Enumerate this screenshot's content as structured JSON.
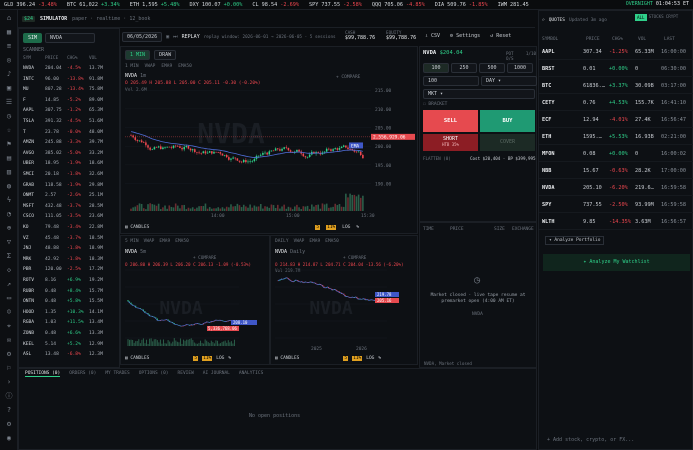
{
  "ticker": [
    {
      "sym": "GLD",
      "px": "396.24",
      "chg": "-3.48%",
      "dir": "neg"
    },
    {
      "sym": "BTC",
      "px": "61,022",
      "chg": "+3.34%",
      "dir": "pos"
    },
    {
      "sym": "ETH",
      "px": "1,595",
      "chg": "+5.48%",
      "dir": "pos"
    },
    {
      "sym": "DXY",
      "px": "100.07",
      "chg": "+0.00%",
      "dir": "pos"
    },
    {
      "sym": "CL",
      "px": "98.54",
      "chg": "-2.69%",
      "dir": "neg"
    },
    {
      "sym": "SPY",
      "px": "737.55",
      "chg": "-2.58%",
      "dir": "neg"
    },
    {
      "sym": "QQQ",
      "px": "705.06",
      "chg": "-4.85%",
      "dir": "neg"
    },
    {
      "sym": "DIA",
      "px": "509.76",
      "chg": "-1.85%",
      "dir": "neg"
    },
    {
      "sym": "IWM",
      "px": "281.45",
      "chg": "",
      "dir": "pos"
    }
  ],
  "ticker_right": {
    "label": "OVERNIGHT",
    "time": "01:04:53 ET"
  },
  "topbar": {
    "badge": "$24",
    "app": "SIMULATOR",
    "mode": "paper · realtime · 12_book",
    "date": "06/05/2026",
    "replay": "REPLAY",
    "replay_window": "replay window: 2026-06-01 → 2026-06-05 · 5 sessions",
    "cash_label": "CASH",
    "cash": "$99,788.76",
    "equity_label": "EQUITY",
    "equity": "$99,788.76",
    "csv": "CSV",
    "settings": "Settings",
    "reset": "Reset"
  },
  "scanner": {
    "tabs": [
      "SIM",
      "NVDA"
    ],
    "title": "SCANNER",
    "cols": [
      "SYM",
      "PRICE",
      "CHG%",
      "VOL"
    ],
    "rows": [
      [
        "NVDA",
        "204.04",
        "-4.5%",
        "13.7M",
        "neg"
      ],
      [
        "INTC",
        "96.00",
        "-13.8%",
        "91.8M",
        "neg"
      ],
      [
        "MU",
        "807.28",
        "-13.4%",
        "75.8M",
        "neg"
      ],
      [
        "F",
        "14.85",
        "-5.2%",
        "89.0M",
        "neg"
      ],
      [
        "AAPL",
        "307.75",
        "-1.2%",
        "65.3M",
        "neg"
      ],
      [
        "TSLA",
        "391.32",
        "-4.5%",
        "51.6M",
        "neg"
      ],
      [
        "T",
        "23.78",
        "-0.0%",
        "48.0M",
        "neg"
      ],
      [
        "AMZN",
        "245.88",
        "-3.3%",
        "39.7M",
        "neg"
      ],
      [
        "AVGO",
        "385.02",
        "-5.0%",
        "33.2M",
        "neg"
      ],
      [
        "UBER",
        "18.95",
        "-1.9%",
        "18.6M",
        "neg"
      ],
      [
        "SMCI",
        "20.18",
        "-1.8%",
        "32.6M",
        "neg"
      ],
      [
        "GRAB",
        "118.58",
        "-1.9%",
        "29.8M",
        "neg"
      ],
      [
        "ONMT",
        "2.57",
        "-2.6%",
        "25.1M",
        "neg"
      ],
      [
        "MSFT",
        "432.48",
        "-3.7%",
        "28.5M",
        "neg"
      ],
      [
        "CSCO",
        "111.05",
        "-3.5%",
        "23.6M",
        "neg"
      ],
      [
        "KO",
        "79.48",
        "-3.4%",
        "22.8M",
        "neg"
      ],
      [
        "VZ",
        "45.48",
        "-3.7%",
        "18.5M",
        "neg"
      ],
      [
        "JNJ",
        "48.88",
        "-1.8%",
        "18.9M",
        "neg"
      ],
      [
        "MRK",
        "42.92",
        "-1.8%",
        "18.3M",
        "neg"
      ],
      [
        "PBR",
        "120.00",
        "-2.5%",
        "17.2M",
        "neg"
      ],
      [
        "ROTV",
        "8.16",
        "+6.9%",
        "19.2M",
        "pos"
      ],
      [
        "RUBR",
        "0.48",
        "+8.4%",
        "15.7M",
        "pos"
      ],
      [
        "ONTN",
        "0.48",
        "+5.8%",
        "15.5M",
        "pos"
      ],
      [
        "HOOD",
        "1.35",
        "+10.3%",
        "14.1M",
        "pos"
      ],
      [
        "RGBA",
        "1.03",
        "+11.5%",
        "13.4M",
        "pos"
      ],
      [
        "ZONB",
        "0.48",
        "+6.6%",
        "13.3M",
        "pos"
      ],
      [
        "KEEL",
        "5.14",
        "+5.2%",
        "12.9M",
        "pos"
      ],
      [
        "ASL",
        "13.48",
        "-6.8%",
        "12.3M",
        "neg"
      ]
    ]
  },
  "chart_main": {
    "tab_active": "1 MIN",
    "tab_alt": "DRAW",
    "sub_tabs": [
      "1 MIN",
      "VWAP",
      "EMA9",
      "EMA50"
    ],
    "symbol": "NVDA",
    "tf": "1m",
    "ohlc": "O 205.49  H 205.88  L 205.00  C 205.11  -0.30 (-0.20%)",
    "vol": "Vol 2.6M",
    "compare": "+ COMPARE",
    "price_tag": "208.60",
    "last_tag": "2,556,929.06",
    "ema_tag": "EMA",
    "watermark": "NVDA",
    "footer": [
      "CANDLES",
      "5",
      "11%",
      "LOG",
      "%"
    ]
  },
  "chart_data": {
    "type": "line",
    "title": "NVDA 1m",
    "yticks": [
      215,
      210,
      205,
      200,
      195,
      190
    ],
    "xticks": [
      "14:00",
      "15:00",
      "15:30"
    ],
    "ylim": [
      188,
      218
    ],
    "series": [
      {
        "name": "EMA"
      }
    ]
  },
  "chart_small_1": {
    "symbol": "NVDA",
    "tf": "5m",
    "sub_tabs": [
      "5 MIN",
      "VWAP",
      "EMA9",
      "EMA50"
    ],
    "ohlc": "O 206.80  H 206.39  L 206.20  C 206.13  -1.09 (-0.53%)",
    "compare": "+ COMPARE",
    "price_tag": "208.10",
    "last_tag": "5,336,768.06",
    "footer": [
      "CANDLES",
      "5",
      "11%",
      "LOG",
      "%"
    ]
  },
  "chart_small_2": {
    "symbol": "NVDA",
    "tf": "Daily",
    "sub_tabs": [
      "DAILY",
      "VWAP",
      "EMA9",
      "EMA50"
    ],
    "ohlc": "O 214.83  H 214.87  L 204.71  C 204.04  -13.56 (-6.20%)",
    "vol": "Vol 219.7M",
    "compare": "+ COMPARE",
    "price_tag": "219.78",
    "last_tag": "205.16",
    "xticks": [
      "2025",
      "2026"
    ],
    "footer": [
      "CANDLES",
      "5",
      "11%",
      "LOG",
      "%"
    ]
  },
  "order_panel": {
    "symbol": "NVDA",
    "price": "$204.04",
    "tags": [
      "POT O/S",
      "1/10"
    ],
    "qty_tabs": [
      "100",
      "250",
      "500",
      "1000"
    ],
    "qty": "100",
    "tif": "DAY",
    "order_type": "MKT",
    "bracket": "BRACKET",
    "sell": "SELL",
    "buy": "BUY",
    "short": "SHORT",
    "short_sub": "HTB 35%",
    "cover": "COVER",
    "flat_label": "FLATTEN (0)",
    "cost": "Cost $20,404 · BP $399,995"
  },
  "tape": {
    "cols": [
      "TIME",
      "PRICE",
      "SIZE",
      "EXCHANGE"
    ],
    "closed_msg": "Market closed · live tape resume at premarket open (4:00 AM ET)",
    "symbol": "NVDA",
    "footer": "NVDA, Market closed"
  },
  "watchlist": {
    "tabs": [
      "QUOTES",
      "Updated 3m ago"
    ],
    "cols": [
      "SYMBOL",
      "PRICE",
      "CHG%",
      "VOL",
      "LAST"
    ],
    "rows": [
      [
        "AAPL",
        "307.34",
        "-1.25%",
        "65.33M",
        "16:00:00",
        "neg"
      ],
      [
        "BRST",
        "0.01",
        "+0.00%",
        "0",
        "06:30:00",
        "pos"
      ],
      [
        "BTC",
        "61836.…",
        "+3.37%",
        "30.09B",
        "03:17:00",
        "pos"
      ],
      [
        "CETY",
        "0.76",
        "+4.53%",
        "155.7K",
        "16:41:10",
        "pos"
      ],
      [
        "ECF",
        "12.94",
        "-4.01%",
        "27.4K",
        "16:56:47",
        "neg"
      ],
      [
        "ETH",
        "1595.…",
        "+5.53%",
        "16.93B",
        "02:21:00",
        "pos"
      ],
      [
        "MFON",
        "0.08",
        "+0.00%",
        "0",
        "16:00:02",
        "pos"
      ],
      [
        "NBB",
        "15.67",
        "-0.63%",
        "28.2K",
        "17:00:00",
        "neg"
      ],
      [
        "NVDA",
        "205.10",
        "-6.20%",
        "219.6…",
        "16:59:58",
        "neg"
      ],
      [
        "SPY",
        "737.55",
        "-2.50%",
        "93.99M",
        "16:59:58",
        "neg"
      ],
      [
        "WLTH",
        "9.85",
        "-14.35%",
        "3.63M",
        "16:56:57",
        "neg"
      ]
    ],
    "analyze_portfolio": "Analyze Portfolio",
    "analyze_watchlist": "Analyze My Watchlist",
    "add_placeholder": "Add stock, crypto, or FX...",
    "header_btns": [
      "ALL",
      "STOCKS",
      "CRYPT"
    ]
  },
  "bottom": {
    "tabs": [
      "POSITIONS (0)",
      "ORDERS (0)",
      "MY TRADES",
      "OPTIONS (0)",
      "REVIEW",
      "AI JOURNAL",
      "ANALYTICS"
    ],
    "empty": "No open positions"
  },
  "colors": {
    "up": "#2fd08a",
    "down": "#f0474f",
    "bg": "#0b0d10",
    "accent": "#2fd08a"
  }
}
